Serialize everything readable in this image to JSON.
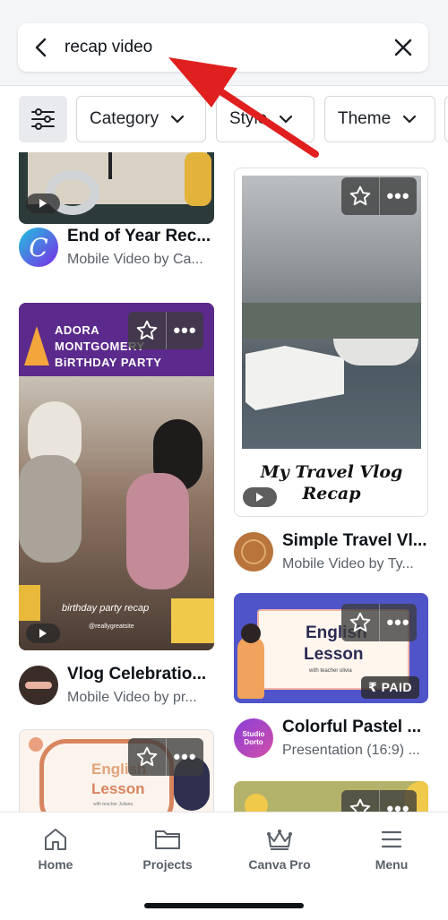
{
  "search": {
    "query": "recap video"
  },
  "filters": [
    {
      "label": "Category"
    },
    {
      "label": "Style"
    },
    {
      "label": "Theme"
    }
  ],
  "results": {
    "left": [
      {
        "title": "End of Year Rec...",
        "subtitle": "Mobile Video by Ca...",
        "avatar_letter": "C"
      },
      {
        "title": "Vlog Celebratio...",
        "subtitle": "Mobile Video by pr...",
        "thumb_header": "ADORA MONTGOMERY BiRTHDAY PARTY",
        "thumb_caption": "birthday party recap",
        "thumb_handle": "@reallygreatsite"
      },
      {
        "thumb_title_1": "English",
        "thumb_title_2": "Lesson",
        "thumb_small": "with teacher Juliana"
      }
    ],
    "right": [
      {
        "title": "Simple Travel Vl...",
        "subtitle": "Mobile Video by Ty...",
        "thumb_script_1": "My Travel Vlog",
        "thumb_script_2": "Recap"
      },
      {
        "title": "Colorful Pastel ...",
        "subtitle": "Presentation (16:9) ...",
        "thumb_title_1": "English",
        "thumb_title_2": "Lesson",
        "thumb_small": "with teacher olivia",
        "badge": "₹ PAID",
        "avatar_text": "Studio Dorto"
      },
      {}
    ]
  },
  "nav": [
    {
      "label": "Home",
      "icon": "home-icon"
    },
    {
      "label": "Projects",
      "icon": "folder-icon"
    },
    {
      "label": "Canva Pro",
      "icon": "crown-icon"
    },
    {
      "label": "Menu",
      "icon": "hamburger-icon"
    }
  ],
  "colors": {
    "accent_arrow": "#e0201f",
    "canva_purple": "#7d2ae8",
    "text": "#0e1318",
    "muted": "#5a6068"
  }
}
